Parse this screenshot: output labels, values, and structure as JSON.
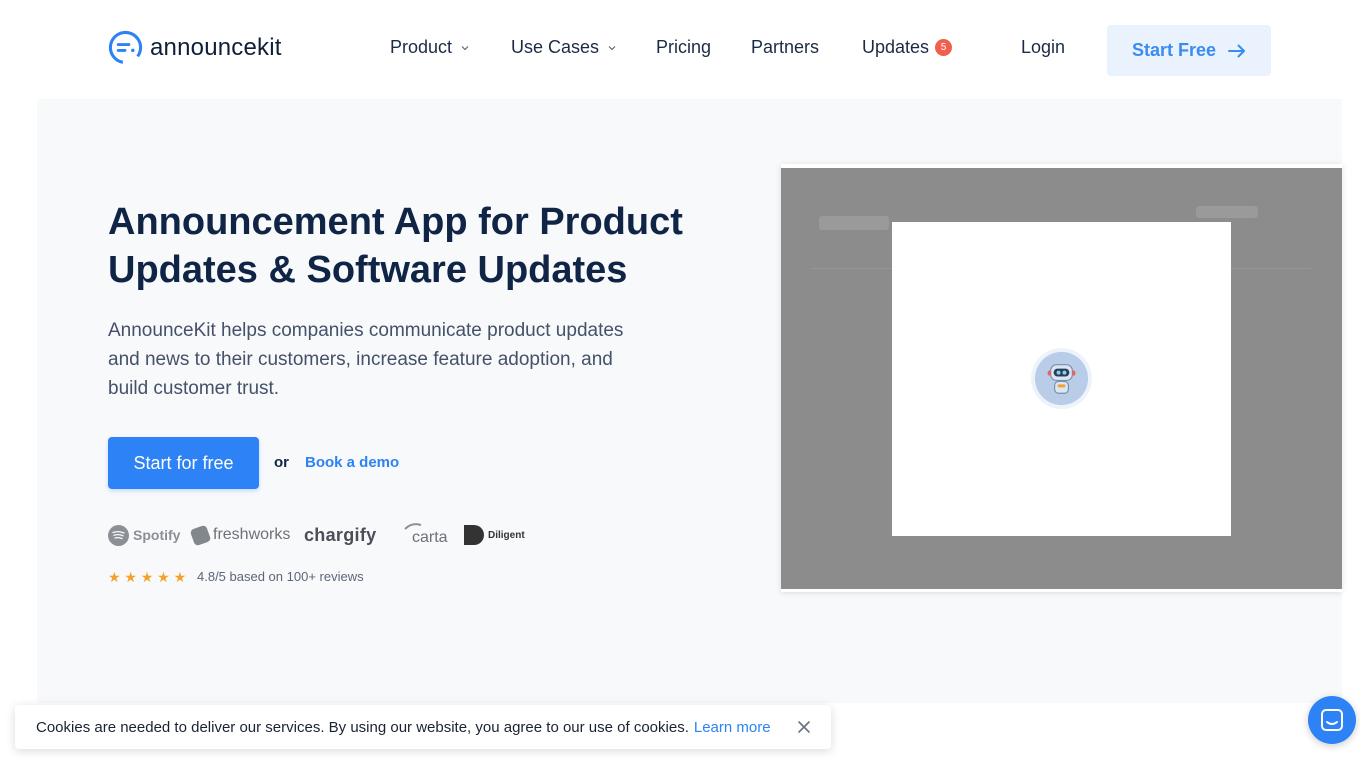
{
  "brand": {
    "name": "announcekit",
    "accent": "#2d83f5",
    "dark": "#102546"
  },
  "nav": {
    "items": [
      {
        "label": "Product",
        "has_dropdown": true
      },
      {
        "label": "Use Cases",
        "has_dropdown": true
      },
      {
        "label": "Pricing"
      },
      {
        "label": "Partners"
      },
      {
        "label": "Updates",
        "badge": "5"
      }
    ],
    "login": "Login",
    "start_free": "Start Free"
  },
  "hero": {
    "headline": "Announcement App for Product Updates & Software Updates",
    "description": "AnnounceKit helps companies communicate product updates and news to their customers, increase feature adoption, and build customer trust.",
    "cta": "Start for free",
    "or": "or",
    "demo": "Book a demo",
    "customer_logos": [
      "Spotify",
      "freshworks",
      "chargify",
      "carta",
      "Diligent"
    ],
    "rating_stars": 5,
    "rating_text": "4.8/5 based on 100+ reviews"
  },
  "preview": {
    "icon": "robot-icon"
  },
  "cookie": {
    "text": "Cookies are needed to deliver our services. By using our website, you agree to our use of cookies.",
    "link": "Learn more"
  },
  "chat": {
    "icon": "chat-icon"
  }
}
